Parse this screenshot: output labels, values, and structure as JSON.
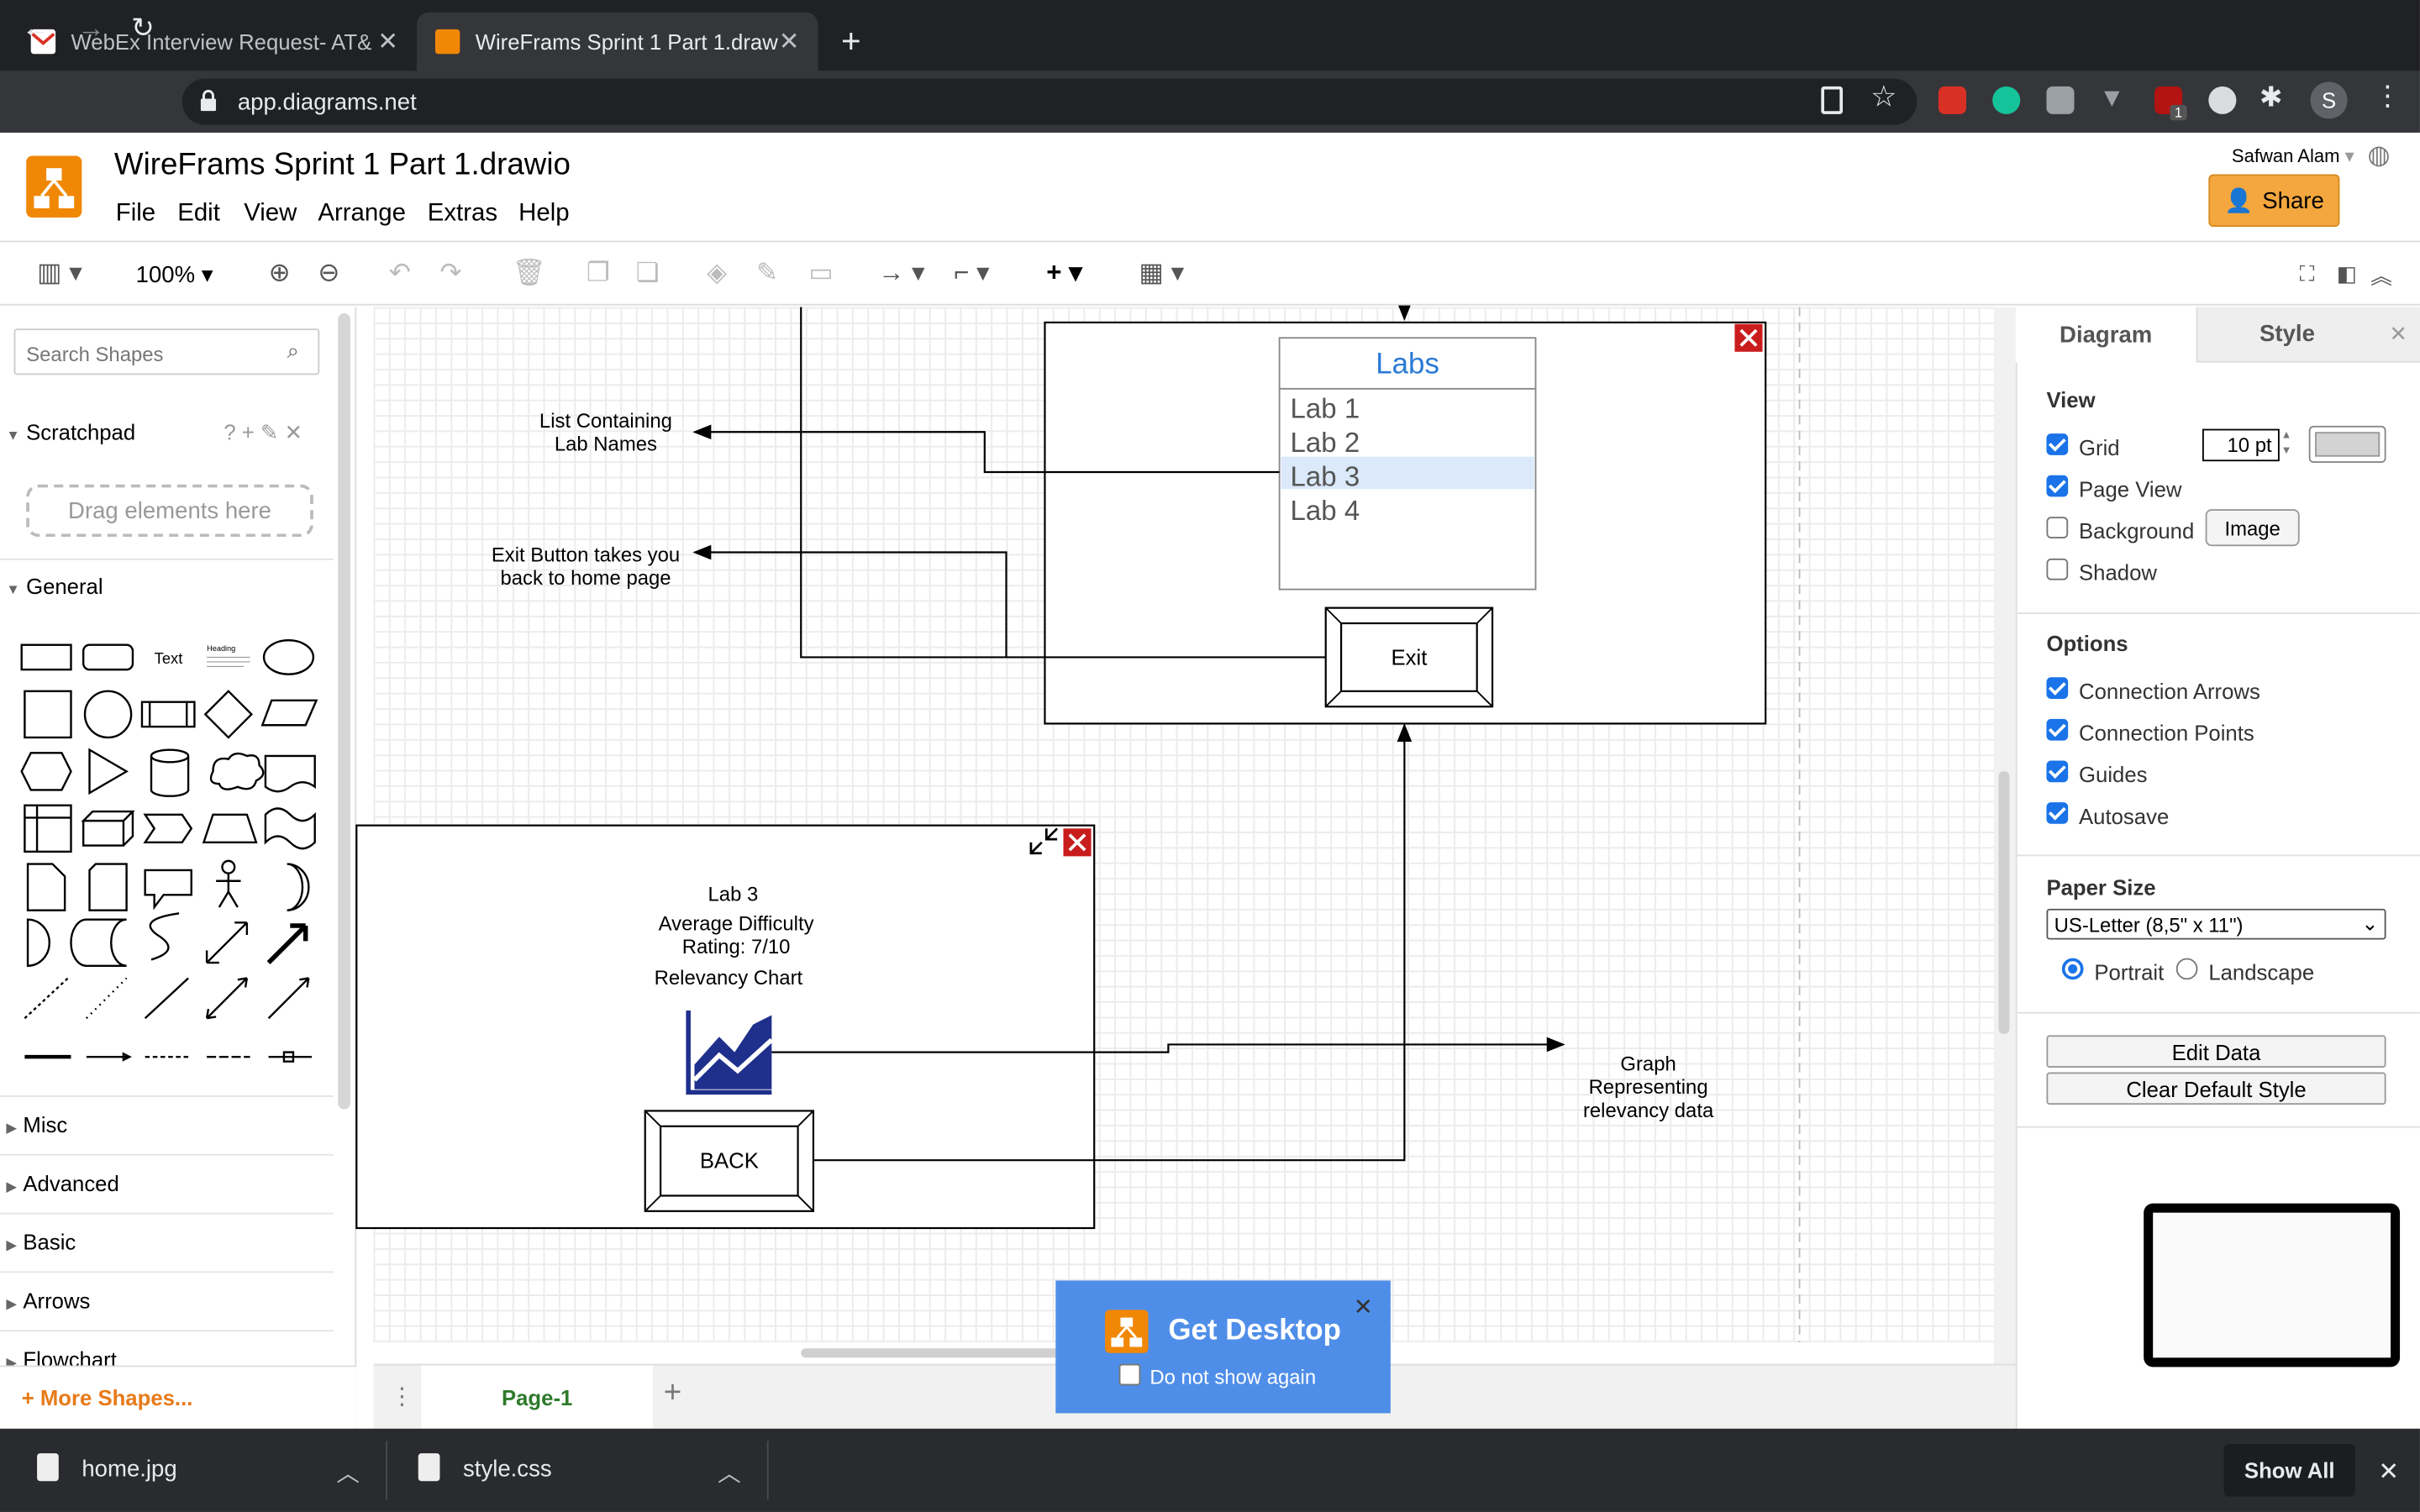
{
  "browser": {
    "tabs": [
      {
        "title": "WebEx Interview Request- AT&",
        "active": false
      },
      {
        "title": "WireFrams Sprint 1 Part 1.draw",
        "active": true
      }
    ],
    "url": "app.diagrams.net",
    "profile_initial": "S",
    "ext_badge": "1"
  },
  "app": {
    "title": "WireFrams Sprint 1 Part 1.drawio",
    "menus": [
      "File",
      "Edit",
      "View",
      "Arrange",
      "Extras",
      "Help"
    ],
    "user": "Safwan Alam",
    "share_label": "Share",
    "zoom": "100%"
  },
  "left_panel": {
    "search_placeholder": "Search Shapes",
    "scratchpad": "Scratchpad",
    "scratchpad_tools": "? + ✎ ✕",
    "drag_text": "Drag elements here",
    "general": "General",
    "shape_text": "Text",
    "shape_heading": "Heading",
    "sections": [
      "Misc",
      "Advanced",
      "Basic",
      "Arrows",
      "Flowchart"
    ],
    "more_shapes": "+ More Shapes..."
  },
  "canvas": {
    "labs_title": "Labs",
    "labs_items": [
      "Lab 1",
      "Lab 2",
      "Lab 3",
      "Lab 4"
    ],
    "exit_label": "Exit",
    "note_list": "List Containing\nLab Names",
    "note_exit": "Exit Button takes you\nback to home page",
    "lab3_title": "Lab 3",
    "lab3_rating": "Average Difficulty\nRating: 7/10",
    "lab3_chart": "Relevancy Chart",
    "back_label": "BACK",
    "note_graph": "Graph\nRepresenting\nrelevancy data",
    "accent": "#1a73e8"
  },
  "pages": {
    "current": "Page-1"
  },
  "right_panel": {
    "tabs": [
      "Diagram",
      "Style"
    ],
    "view_heading": "View",
    "grid_label": "Grid",
    "grid_size": "10 pt",
    "page_view": "Page View",
    "background": "Background",
    "image_button": "Image",
    "shadow": "Shadow",
    "options_heading": "Options",
    "options": [
      "Connection Arrows",
      "Connection Points",
      "Guides",
      "Autosave"
    ],
    "paper_heading": "Paper Size",
    "paper_size": "US-Letter (8,5\" x 11\")",
    "portrait": "Portrait",
    "landscape": "Landscape",
    "edit_data": "Edit Data",
    "clear_style": "Clear Default Style"
  },
  "popup": {
    "title": "Get Desktop",
    "checkbox": "Do not show again"
  },
  "downloads": {
    "items": [
      "home.jpg",
      "style.css"
    ],
    "show_all": "Show All"
  }
}
